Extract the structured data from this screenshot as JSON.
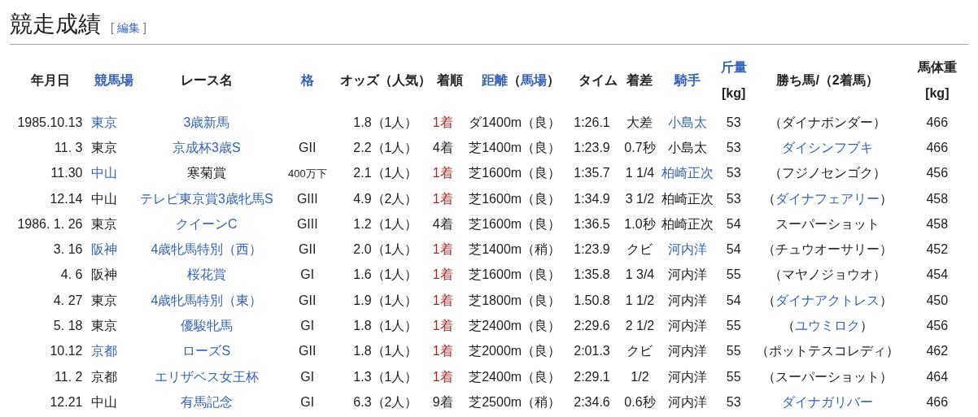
{
  "heading": {
    "title": "競走成績",
    "edit_bracket_open": "[",
    "edit_link": "編集",
    "edit_bracket_close": "]"
  },
  "table": {
    "columns": [
      {
        "lines": [
          [
            {
              "text": "年月日",
              "link": false
            }
          ]
        ]
      },
      {
        "lines": [
          [
            {
              "text": "競馬場",
              "link": true
            }
          ]
        ]
      },
      {
        "lines": [
          [
            {
              "text": "レース名",
              "link": false
            }
          ]
        ]
      },
      {
        "lines": [
          [
            {
              "text": "格",
              "link": true
            }
          ]
        ]
      },
      {
        "lines": [
          [
            {
              "text": "オッズ（人気）",
              "link": false
            }
          ]
        ]
      },
      {
        "lines": [
          [
            {
              "text": "着順",
              "link": false
            }
          ]
        ]
      },
      {
        "lines": [
          [
            {
              "text": "距離",
              "link": true
            },
            {
              "text": "（",
              "link": false
            },
            {
              "text": "馬場",
              "link": true
            },
            {
              "text": "）",
              "link": false
            }
          ]
        ]
      },
      {
        "lines": [
          [
            {
              "text": "タイム",
              "link": false
            }
          ]
        ]
      },
      {
        "lines": [
          [
            {
              "text": "着差",
              "link": false
            }
          ]
        ]
      },
      {
        "lines": [
          [
            {
              "text": "騎手",
              "link": true
            }
          ]
        ]
      },
      {
        "lines": [
          [
            {
              "text": "斤量",
              "link": true
            }
          ],
          [
            {
              "text": "[kg]",
              "link": false
            }
          ]
        ]
      },
      {
        "lines": [
          [
            {
              "text": "勝ち馬/（2着馬）",
              "link": false
            }
          ]
        ]
      },
      {
        "lines": [
          [
            {
              "text": "馬体重",
              "link": false
            }
          ],
          [
            {
              "text": "[kg]",
              "link": false
            }
          ]
        ]
      }
    ],
    "rows": [
      {
        "cells": [
          [
            {
              "text": "1985.10.13",
              "link": false
            }
          ],
          [
            {
              "text": "東京",
              "link": true
            }
          ],
          [
            {
              "text": "3歳新馬",
              "link": true
            }
          ],
          [],
          [
            {
              "text": "1.8（1人）",
              "link": false
            }
          ],
          [
            {
              "text": "1着",
              "link": false,
              "win": true
            }
          ],
          [
            {
              "text": "ダ1400m（良）",
              "link": false
            }
          ],
          [
            {
              "text": "1:26.1",
              "link": false
            }
          ],
          [
            {
              "text": "大差",
              "link": false
            }
          ],
          [
            {
              "text": "小島太",
              "link": true
            }
          ],
          [
            {
              "text": "53",
              "link": false
            }
          ],
          [
            {
              "text": "（ダイナボンダー）",
              "link": false
            }
          ],
          [
            {
              "text": "466",
              "link": false
            }
          ]
        ]
      },
      {
        "cells": [
          [
            {
              "text": "11. 3",
              "link": false
            }
          ],
          [
            {
              "text": "東京",
              "link": false
            }
          ],
          [
            {
              "text": "京成杯3歳S",
              "link": true
            }
          ],
          [
            {
              "text": "GII",
              "link": false
            }
          ],
          [
            {
              "text": "2.2（1人）",
              "link": false
            }
          ],
          [
            {
              "text": "4着",
              "link": false,
              "win": false
            }
          ],
          [
            {
              "text": "芝1400m（良）",
              "link": false
            }
          ],
          [
            {
              "text": "1:23.9",
              "link": false
            }
          ],
          [
            {
              "text": "0.7秒",
              "link": false
            }
          ],
          [
            {
              "text": "小島太",
              "link": false
            }
          ],
          [
            {
              "text": "53",
              "link": false
            }
          ],
          [
            {
              "text": "ダイシンフブキ",
              "link": true
            }
          ],
          [
            {
              "text": "466",
              "link": false
            }
          ]
        ]
      },
      {
        "cells": [
          [
            {
              "text": "11.30",
              "link": false
            }
          ],
          [
            {
              "text": "中山",
              "link": true
            }
          ],
          [
            {
              "text": "寒菊賞",
              "link": false
            }
          ],
          [
            {
              "text": "400万下",
              "link": false,
              "small": true
            }
          ],
          [
            {
              "text": "2.1（1人）",
              "link": false
            }
          ],
          [
            {
              "text": "1着",
              "link": false,
              "win": true
            }
          ],
          [
            {
              "text": "芝1600m（良）",
              "link": false
            }
          ],
          [
            {
              "text": "1:35.7",
              "link": false
            }
          ],
          [
            {
              "text": "1 1/4",
              "link": false
            }
          ],
          [
            {
              "text": "柏崎正次",
              "link": true
            }
          ],
          [
            {
              "text": "53",
              "link": false
            }
          ],
          [
            {
              "text": "（フジノセンゴク）",
              "link": false
            }
          ],
          [
            {
              "text": "456",
              "link": false
            }
          ]
        ]
      },
      {
        "cells": [
          [
            {
              "text": "12.14",
              "link": false
            }
          ],
          [
            {
              "text": "中山",
              "link": false
            }
          ],
          [
            {
              "text": "テレビ東京賞3歳牝馬S",
              "link": true
            }
          ],
          [
            {
              "text": "GIII",
              "link": false
            }
          ],
          [
            {
              "text": "4.9（2人）",
              "link": false
            }
          ],
          [
            {
              "text": "1着",
              "link": false,
              "win": true
            }
          ],
          [
            {
              "text": "芝1600m（良）",
              "link": false
            }
          ],
          [
            {
              "text": "1:34.9",
              "link": false
            }
          ],
          [
            {
              "text": "3 1/2",
              "link": false
            }
          ],
          [
            {
              "text": "柏崎正次",
              "link": false
            }
          ],
          [
            {
              "text": "53",
              "link": false
            }
          ],
          [
            {
              "text": "（",
              "link": false
            },
            {
              "text": "ダイナフェアリー",
              "link": true
            },
            {
              "text": "）",
              "link": false
            }
          ],
          [
            {
              "text": "458",
              "link": false
            }
          ]
        ]
      },
      {
        "cells": [
          [
            {
              "text": "1986. 1. 26",
              "link": false
            }
          ],
          [
            {
              "text": "東京",
              "link": false
            }
          ],
          [
            {
              "text": "クイーンC",
              "link": true
            }
          ],
          [
            {
              "text": "GIII",
              "link": false
            }
          ],
          [
            {
              "text": "1.2（1人）",
              "link": false
            }
          ],
          [
            {
              "text": "4着",
              "link": false,
              "win": false
            }
          ],
          [
            {
              "text": "芝1600m（良）",
              "link": false
            }
          ],
          [
            {
              "text": "1:36.5",
              "link": false
            }
          ],
          [
            {
              "text": "1.0秒",
              "link": false
            }
          ],
          [
            {
              "text": "柏崎正次",
              "link": false
            }
          ],
          [
            {
              "text": "54",
              "link": false
            }
          ],
          [
            {
              "text": "スーパーショット",
              "link": false
            }
          ],
          [
            {
              "text": "458",
              "link": false
            }
          ]
        ]
      },
      {
        "cells": [
          [
            {
              "text": "3. 16",
              "link": false
            }
          ],
          [
            {
              "text": "阪神",
              "link": true
            }
          ],
          [
            {
              "text": "4歳牝馬特別（西）",
              "link": true
            }
          ],
          [
            {
              "text": "GII",
              "link": false
            }
          ],
          [
            {
              "text": "2.0（1人）",
              "link": false
            }
          ],
          [
            {
              "text": "1着",
              "link": false,
              "win": true
            }
          ],
          [
            {
              "text": "芝1400m（稍）",
              "link": false
            }
          ],
          [
            {
              "text": "1:23.9",
              "link": false
            }
          ],
          [
            {
              "text": "クビ",
              "link": false
            }
          ],
          [
            {
              "text": "河内洋",
              "link": true
            }
          ],
          [
            {
              "text": "54",
              "link": false
            }
          ],
          [
            {
              "text": "（チュウオーサリー）",
              "link": false
            }
          ],
          [
            {
              "text": "452",
              "link": false
            }
          ]
        ]
      },
      {
        "cells": [
          [
            {
              "text": "4.  6",
              "link": false
            }
          ],
          [
            {
              "text": "阪神",
              "link": false
            }
          ],
          [
            {
              "text": "桜花賞",
              "link": true
            }
          ],
          [
            {
              "text": "GI",
              "link": false
            }
          ],
          [
            {
              "text": "1.6（1人）",
              "link": false
            }
          ],
          [
            {
              "text": "1着",
              "link": false,
              "win": true
            }
          ],
          [
            {
              "text": "芝1600m（良）",
              "link": false
            }
          ],
          [
            {
              "text": "1:35.8",
              "link": false
            }
          ],
          [
            {
              "text": "1 3/4",
              "link": false
            }
          ],
          [
            {
              "text": "河内洋",
              "link": false
            }
          ],
          [
            {
              "text": "55",
              "link": false
            }
          ],
          [
            {
              "text": "（マヤノジョウオ）",
              "link": false
            }
          ],
          [
            {
              "text": "454",
              "link": false
            }
          ]
        ]
      },
      {
        "cells": [
          [
            {
              "text": "4. 27",
              "link": false
            }
          ],
          [
            {
              "text": "東京",
              "link": false
            }
          ],
          [
            {
              "text": "4歳牝馬特別（東）",
              "link": true
            }
          ],
          [
            {
              "text": "GII",
              "link": false
            }
          ],
          [
            {
              "text": "1.9（1人）",
              "link": false
            }
          ],
          [
            {
              "text": "1着",
              "link": false,
              "win": true
            }
          ],
          [
            {
              "text": "芝1800m（良）",
              "link": false
            }
          ],
          [
            {
              "text": "1.50.8",
              "link": false
            }
          ],
          [
            {
              "text": "1 1/2",
              "link": false
            }
          ],
          [
            {
              "text": "河内洋",
              "link": false
            }
          ],
          [
            {
              "text": "54",
              "link": false
            }
          ],
          [
            {
              "text": "（",
              "link": false
            },
            {
              "text": "ダイナアクトレス",
              "link": true
            },
            {
              "text": "）",
              "link": false
            }
          ],
          [
            {
              "text": "450",
              "link": false
            }
          ]
        ]
      },
      {
        "cells": [
          [
            {
              "text": "5. 18",
              "link": false
            }
          ],
          [
            {
              "text": "東京",
              "link": false
            }
          ],
          [
            {
              "text": "優駿牝馬",
              "link": true
            }
          ],
          [
            {
              "text": "GI",
              "link": false
            }
          ],
          [
            {
              "text": "1.8（1人）",
              "link": false
            }
          ],
          [
            {
              "text": "1着",
              "link": false,
              "win": true
            }
          ],
          [
            {
              "text": "芝2400m（良）",
              "link": false
            }
          ],
          [
            {
              "text": "2:29.6",
              "link": false
            }
          ],
          [
            {
              "text": "2 1/2",
              "link": false
            }
          ],
          [
            {
              "text": "河内洋",
              "link": false
            }
          ],
          [
            {
              "text": "55",
              "link": false
            }
          ],
          [
            {
              "text": "（",
              "link": false
            },
            {
              "text": "ユウミロク",
              "link": true
            },
            {
              "text": "）",
              "link": false
            }
          ],
          [
            {
              "text": "456",
              "link": false
            }
          ]
        ]
      },
      {
        "cells": [
          [
            {
              "text": "10.12",
              "link": false
            }
          ],
          [
            {
              "text": "京都",
              "link": true
            }
          ],
          [
            {
              "text": "ローズS",
              "link": true
            }
          ],
          [
            {
              "text": "GII",
              "link": false
            }
          ],
          [
            {
              "text": "1.8（1人）",
              "link": false
            }
          ],
          [
            {
              "text": "1着",
              "link": false,
              "win": true
            }
          ],
          [
            {
              "text": "芝2000m（良）",
              "link": false
            }
          ],
          [
            {
              "text": "2:01.3",
              "link": false
            }
          ],
          [
            {
              "text": "クビ",
              "link": false
            }
          ],
          [
            {
              "text": "河内洋",
              "link": false
            }
          ],
          [
            {
              "text": "55",
              "link": false
            }
          ],
          [
            {
              "text": "（ポットテスコレディ）",
              "link": false
            }
          ],
          [
            {
              "text": "462",
              "link": false
            }
          ]
        ]
      },
      {
        "cells": [
          [
            {
              "text": "11. 2",
              "link": false
            }
          ],
          [
            {
              "text": "京都",
              "link": false
            }
          ],
          [
            {
              "text": "エリザベス女王杯",
              "link": true
            }
          ],
          [
            {
              "text": "GI",
              "link": false
            }
          ],
          [
            {
              "text": "1.3（1人）",
              "link": false
            }
          ],
          [
            {
              "text": "1着",
              "link": false,
              "win": true
            }
          ],
          [
            {
              "text": "芝2400m（良）",
              "link": false
            }
          ],
          [
            {
              "text": "2:29.1",
              "link": false
            }
          ],
          [
            {
              "text": "1/2",
              "link": false
            }
          ],
          [
            {
              "text": "河内洋",
              "link": false
            }
          ],
          [
            {
              "text": "55",
              "link": false
            }
          ],
          [
            {
              "text": "（スーパーショット）",
              "link": false
            }
          ],
          [
            {
              "text": "464",
              "link": false
            }
          ]
        ]
      },
      {
        "cells": [
          [
            {
              "text": "12.21",
              "link": false
            }
          ],
          [
            {
              "text": "中山",
              "link": false
            }
          ],
          [
            {
              "text": "有馬記念",
              "link": true
            }
          ],
          [
            {
              "text": "GI",
              "link": false
            }
          ],
          [
            {
              "text": "6.3（2人）",
              "link": false
            }
          ],
          [
            {
              "text": "9着",
              "link": false,
              "win": false
            }
          ],
          [
            {
              "text": "芝2500m（稍）",
              "link": false
            }
          ],
          [
            {
              "text": "2:34.6",
              "link": false
            }
          ],
          [
            {
              "text": "0.6秒",
              "link": false
            }
          ],
          [
            {
              "text": "河内洋",
              "link": false
            }
          ],
          [
            {
              "text": "53",
              "link": false
            }
          ],
          [
            {
              "text": "ダイナガリバー",
              "link": true
            }
          ],
          [
            {
              "text": "466",
              "link": false
            }
          ]
        ]
      }
    ]
  }
}
